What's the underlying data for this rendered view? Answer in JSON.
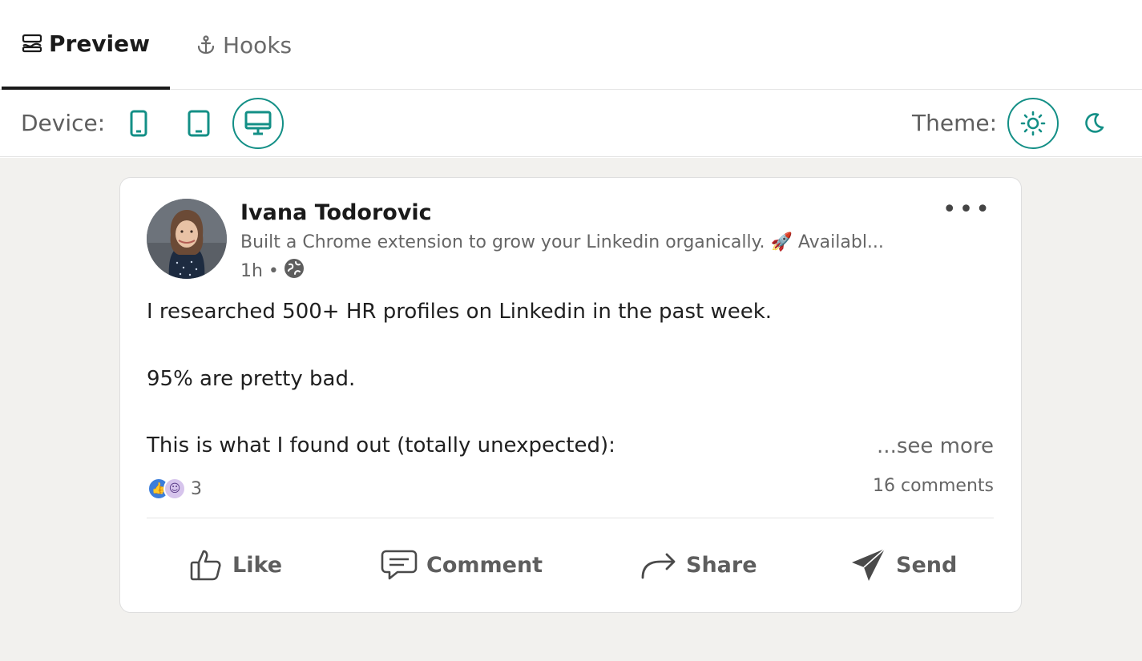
{
  "tabs": [
    {
      "label": "Preview",
      "icon": "preview-icon",
      "active": true
    },
    {
      "label": "Hooks",
      "icon": "anchor-icon",
      "active": false
    }
  ],
  "toolbar": {
    "device_label": "Device:",
    "devices": [
      "mobile-icon",
      "tablet-icon",
      "desktop-icon"
    ],
    "active_device": "desktop",
    "theme_label": "Theme:",
    "themes": [
      "sun-icon",
      "moon-icon"
    ],
    "active_theme": "light"
  },
  "post": {
    "author": "Ivana Todorovic",
    "headline": "Built a Chrome extension to grow your Linkedin organically. 🚀 Availabl...",
    "time": "1h •",
    "lines": [
      "I researched 500+ HR profiles on Linkedin in the past week.",
      "95% are pretty bad.",
      "This is what I found out (totally unexpected):"
    ],
    "see_more": "...see more",
    "reaction_count": "3",
    "comments": "16 comments",
    "actions": {
      "like": "Like",
      "comment": "Comment",
      "share": "Share",
      "send": "Send"
    }
  },
  "colors": {
    "accent": "#138f86",
    "canvas": "#f2f1ee",
    "reaction_like": "#3b7ddb"
  }
}
